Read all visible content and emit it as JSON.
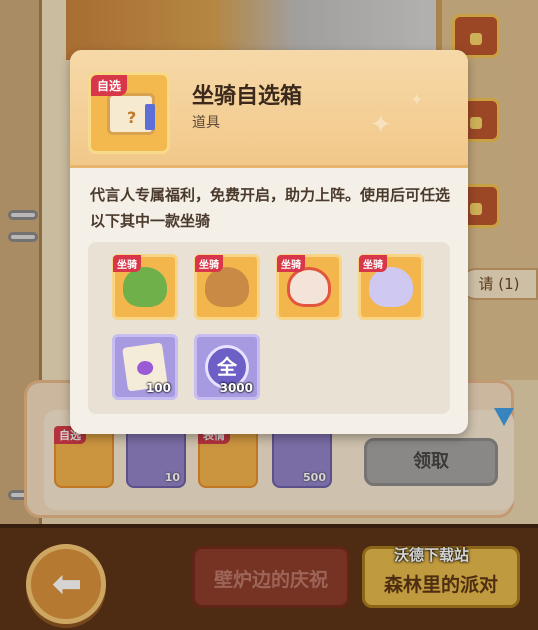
{
  "background": {
    "invite_label": "请 (1)",
    "reward_slots": [
      {
        "tag": "自选",
        "qty": ""
      },
      {
        "tag": "",
        "qty": "10"
      },
      {
        "tag": "表情",
        "qty": ""
      },
      {
        "tag": "",
        "qty": "500"
      }
    ],
    "claim_label": "领取",
    "tabs": [
      {
        "label": "壁炉边的庆祝",
        "state": "inactive"
      },
      {
        "label": "森林里的派对",
        "state": "active"
      }
    ],
    "watermark": "沃德下载站"
  },
  "popup": {
    "item_tag": "自选",
    "item_title": "坐骑自选箱",
    "item_type": "道具",
    "description": "代言人专属福利，免费开启，助力上阵。使用后可任选以下其中一款坐骑",
    "options": [
      {
        "tag": "坐骑",
        "icon": "green-dragon-mount-icon",
        "qty": ""
      },
      {
        "tag": "坐骑",
        "icon": "owl-pilot-mount-icon",
        "qty": ""
      },
      {
        "tag": "坐骑",
        "icon": "lion-dance-mount-icon",
        "qty": ""
      },
      {
        "tag": "坐骑",
        "icon": "ghost-elephant-mount-icon",
        "qty": ""
      },
      {
        "tag": "",
        "icon": "scroll-card-icon",
        "qty": "100"
      },
      {
        "tag": "",
        "icon": "all-orb-icon",
        "glyph": "全",
        "qty": "3000"
      }
    ]
  },
  "colors": {
    "accent_orange": "#f3b64c",
    "accent_purple": "#a89ae0",
    "tag_red": "#d8374a",
    "active_tab": "#e5b94b"
  }
}
